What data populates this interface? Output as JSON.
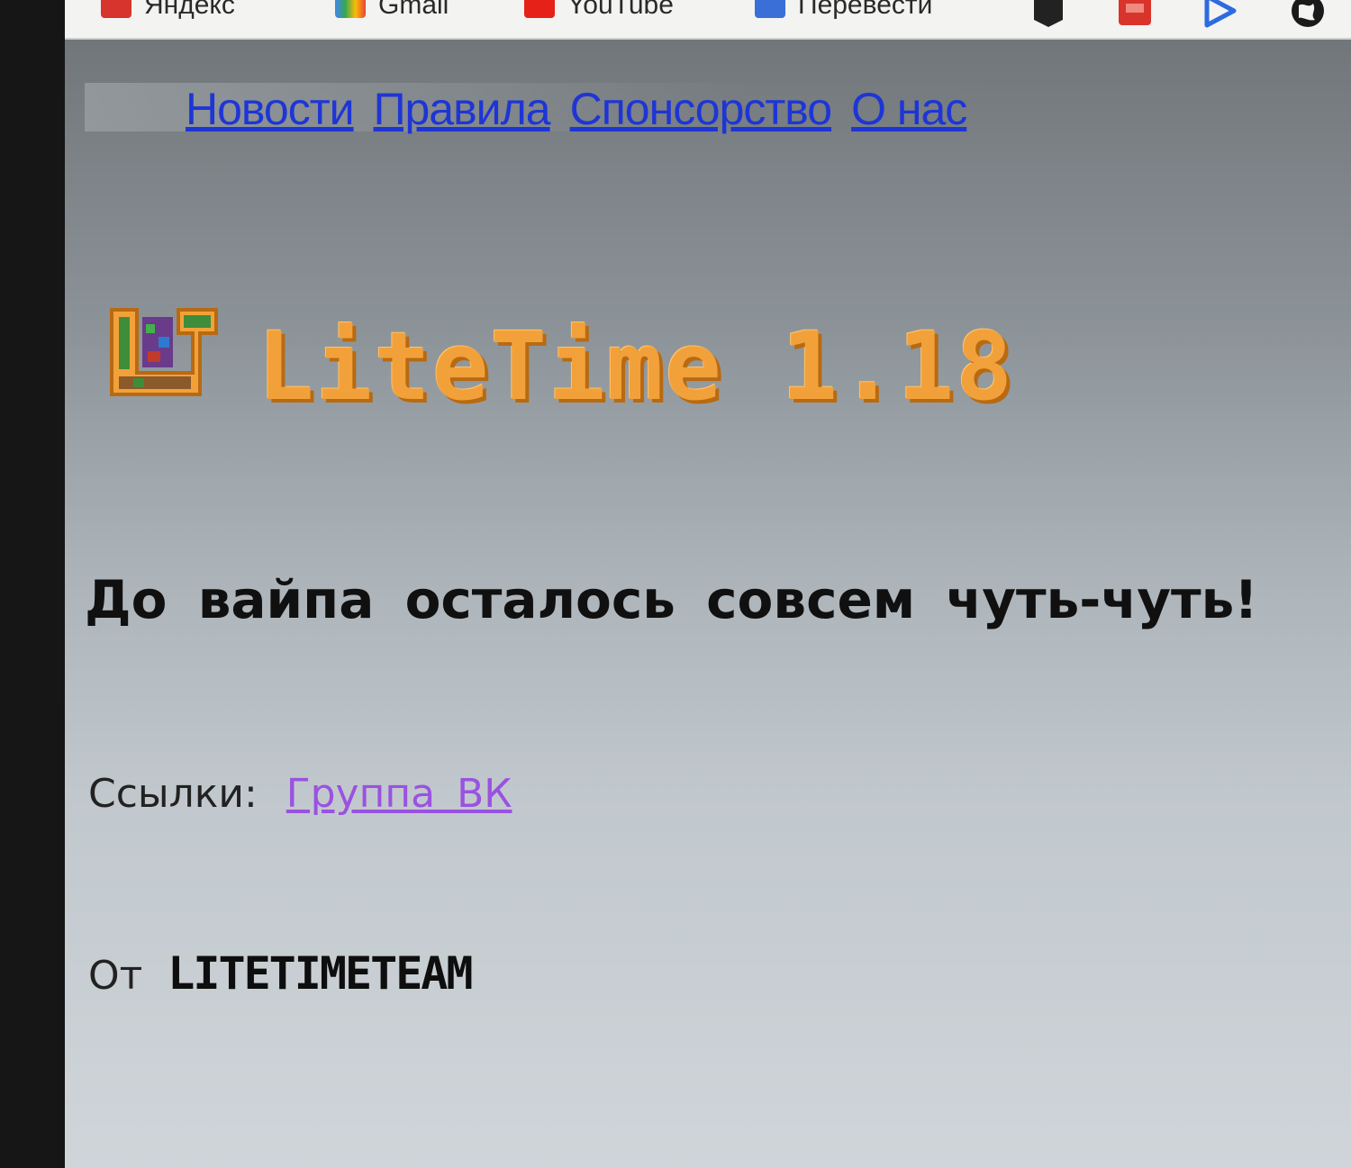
{
  "bookmarks": [
    {
      "label": "Яндекс"
    },
    {
      "label": "Gmail"
    },
    {
      "label": "YouTube"
    },
    {
      "label": "Перевести"
    }
  ],
  "nav": {
    "news": "Новости",
    "rules": "Правила",
    "sponsorship": "Спонсорство",
    "about": "О нас"
  },
  "logo": {
    "title": "LiteTime 1.18"
  },
  "wipe_message": "До вайпа осталось совсем чуть-чуть!",
  "links": {
    "label": "Ссылки:",
    "vk_group": "Группа ВК"
  },
  "author": {
    "prefix": "От",
    "team": "LITETIMETEAM"
  },
  "colors": {
    "nav_link": "#1e35d6",
    "visited_link": "#9a52e0",
    "logo_orange": "#f2a13a"
  }
}
